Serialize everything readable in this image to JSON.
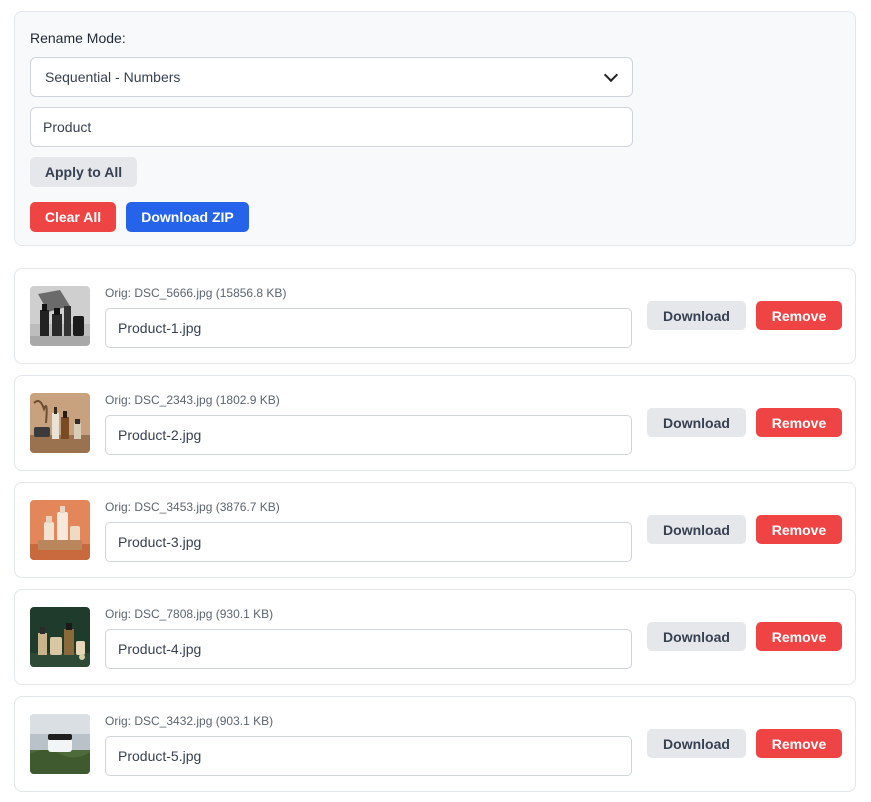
{
  "controls": {
    "mode_label": "Rename Mode:",
    "mode_selected": "Sequential - Numbers",
    "prefix_value": "Product",
    "apply_label": "Apply to All",
    "clear_label": "Clear All",
    "zip_label": "Download ZIP"
  },
  "files": [
    {
      "orig": "Orig: DSC_5666.jpg (15856.8 KB)",
      "name": "Product-1.jpg",
      "download_label": "Download",
      "remove_label": "Remove"
    },
    {
      "orig": "Orig: DSC_2343.jpg (1802.9 KB)",
      "name": "Product-2.jpg",
      "download_label": "Download",
      "remove_label": "Remove"
    },
    {
      "orig": "Orig: DSC_3453.jpg (3876.7 KB)",
      "name": "Product-3.jpg",
      "download_label": "Download",
      "remove_label": "Remove"
    },
    {
      "orig": "Orig: DSC_7808.jpg (930.1 KB)",
      "name": "Product-4.jpg",
      "download_label": "Download",
      "remove_label": "Remove"
    },
    {
      "orig": "Orig: DSC_3432.jpg (903.1 KB)",
      "name": "Product-5.jpg",
      "download_label": "Download",
      "remove_label": "Remove"
    }
  ],
  "colors": {
    "danger": "#ef4444",
    "primary": "#2563eb",
    "neutral": "#e5e7eb"
  },
  "icons": {
    "select_arrow": "chevron-down-icon"
  }
}
